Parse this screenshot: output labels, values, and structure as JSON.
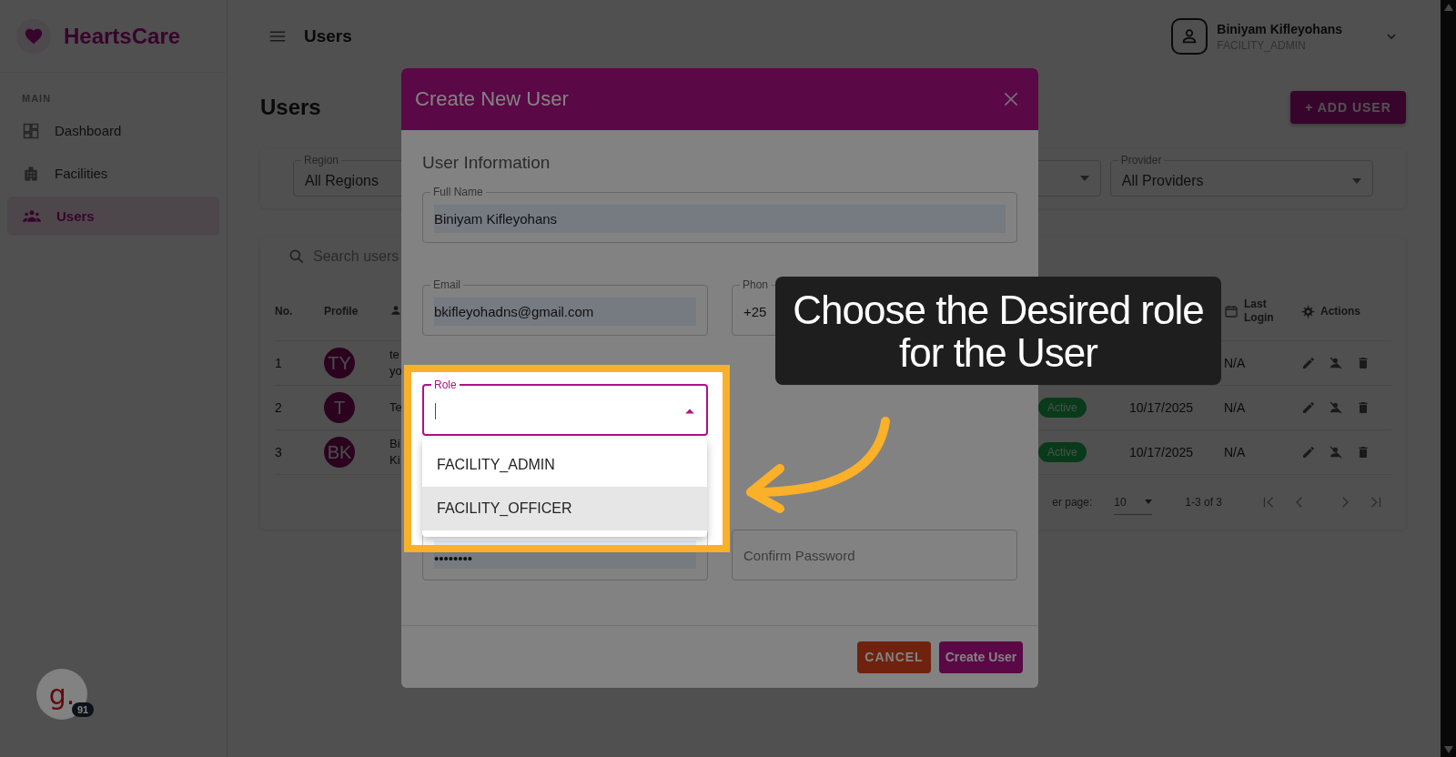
{
  "sidebar": {
    "brand": "HeartsCare",
    "section": "MAIN",
    "items": [
      {
        "label": "Dashboard",
        "selected": false
      },
      {
        "label": "Facilities",
        "selected": false
      },
      {
        "label": "Users",
        "selected": true
      }
    ]
  },
  "header": {
    "title": "Users",
    "user": {
      "name": "Biniyam Kifleyohans",
      "role": "FACILITY_ADMIN"
    }
  },
  "page": {
    "title": "Users",
    "add_button": "+ ADD USER",
    "filters": [
      {
        "label": "Region",
        "value": "All Regions"
      },
      {
        "label": "Provider",
        "value": "All Providers"
      }
    ],
    "search": {
      "placeholder": "Search users"
    },
    "table": {
      "header": {
        "no": "No.",
        "profile": "Profile",
        "last_login": "Last Login",
        "actions": "Actions"
      },
      "rows": [
        {
          "no": "1",
          "initials": "TY",
          "name_lines": [
            "te",
            "yo"
          ],
          "last_login": "N/A"
        },
        {
          "no": "2",
          "initials": "T",
          "name_lines": [
            "Te"
          ],
          "status": "Active",
          "created": "10/17/2025",
          "last_login": "N/A"
        },
        {
          "no": "3",
          "initials": "BK",
          "name_lines": [
            "Bi",
            "Ki"
          ],
          "status": "Active",
          "created": "10/17/2025",
          "last_login": "N/A"
        }
      ]
    },
    "pagination": {
      "rows_label": "er page:",
      "rows_value": "10",
      "range": "1-3 of 3"
    }
  },
  "modal": {
    "title": "Create New User",
    "section": "User Information",
    "rows": [
      [
        {
          "kind": "text",
          "label": "Full Name",
          "value": "Biniyam Kifleyohans",
          "autofilled": true,
          "wide": true
        }
      ],
      [
        {
          "kind": "text",
          "label": "Email",
          "value": "bkifleyohadns@gmail.com",
          "autofilled": true
        },
        {
          "kind": "text",
          "label": "Phon",
          "value": "+25",
          "autofilled": false
        }
      ],
      [
        {
          "kind": "select",
          "label": "Role",
          "focused": true,
          "options": [
            {
              "label": "FACILITY_ADMIN",
              "hovered": false
            },
            {
              "label": "FACILITY_OFFICER",
              "hovered": true
            }
          ]
        }
      ],
      [
        {
          "kind": "text",
          "value": "••••••••",
          "autofilled": true
        },
        {
          "kind": "text",
          "placeholder": "Confirm Password",
          "autofilled": false
        }
      ]
    ],
    "buttons": {
      "cancel": "CANCEL",
      "create": "Create User"
    }
  },
  "callout": {
    "text": "Choose the Desired role for the User"
  },
  "widget": {
    "logo": "g.",
    "badge": "91"
  }
}
